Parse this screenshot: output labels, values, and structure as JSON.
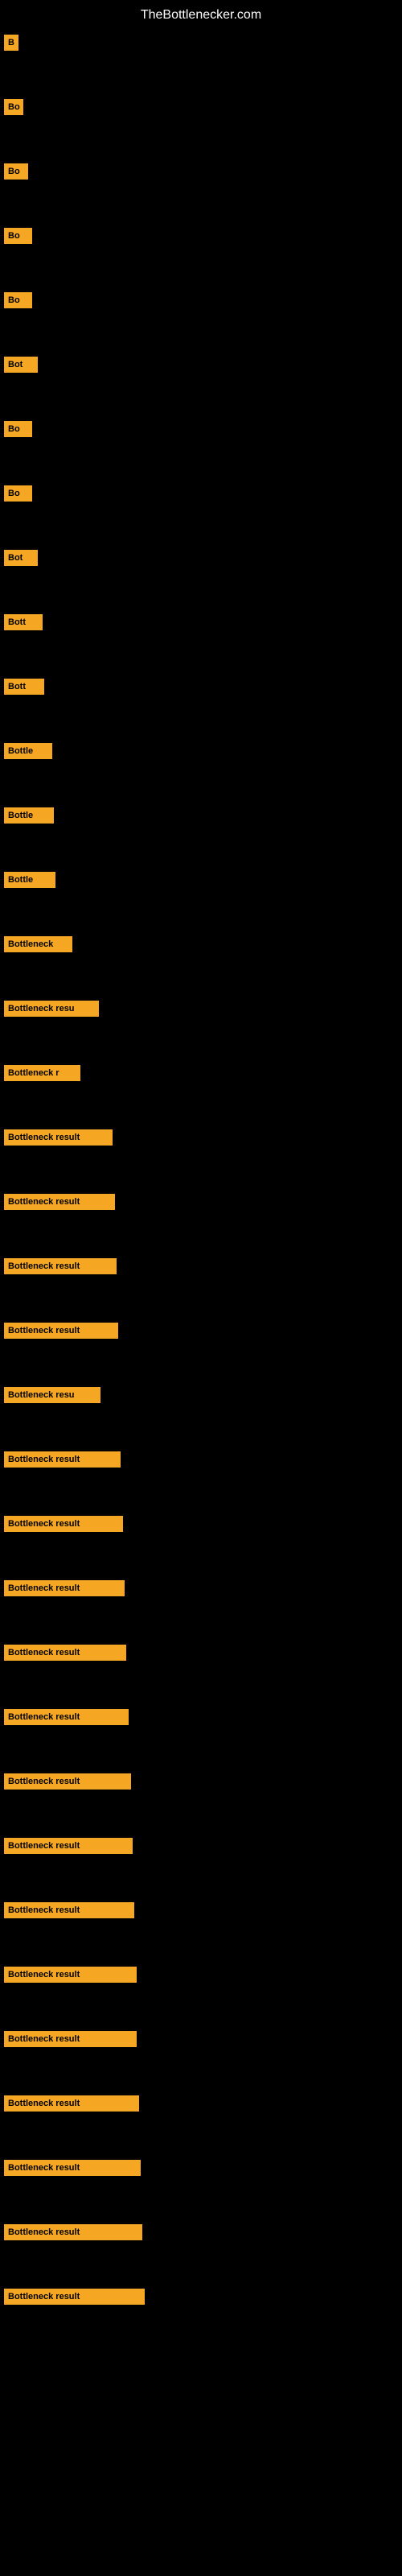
{
  "site": {
    "title": "TheBottlenecker.com"
  },
  "badges": [
    {
      "id": 1,
      "text": "B",
      "width": 18
    },
    {
      "id": 2,
      "text": "Bo",
      "width": 24
    },
    {
      "id": 3,
      "text": "Bo",
      "width": 30
    },
    {
      "id": 4,
      "text": "Bo",
      "width": 35
    },
    {
      "id": 5,
      "text": "Bo",
      "width": 35
    },
    {
      "id": 6,
      "text": "Bot",
      "width": 42
    },
    {
      "id": 7,
      "text": "Bo",
      "width": 35
    },
    {
      "id": 8,
      "text": "Bo",
      "width": 35
    },
    {
      "id": 9,
      "text": "Bot",
      "width": 42
    },
    {
      "id": 10,
      "text": "Bott",
      "width": 48
    },
    {
      "id": 11,
      "text": "Bott",
      "width": 50
    },
    {
      "id": 12,
      "text": "Bottle",
      "width": 60
    },
    {
      "id": 13,
      "text": "Bottle",
      "width": 62
    },
    {
      "id": 14,
      "text": "Bottle",
      "width": 64
    },
    {
      "id": 15,
      "text": "Bottleneck",
      "width": 85
    },
    {
      "id": 16,
      "text": "Bottleneck resu",
      "width": 118
    },
    {
      "id": 17,
      "text": "Bottleneck r",
      "width": 95
    },
    {
      "id": 18,
      "text": "Bottleneck result",
      "width": 135
    },
    {
      "id": 19,
      "text": "Bottleneck result",
      "width": 138
    },
    {
      "id": 20,
      "text": "Bottleneck result",
      "width": 140
    },
    {
      "id": 21,
      "text": "Bottleneck result",
      "width": 142
    },
    {
      "id": 22,
      "text": "Bottleneck resu",
      "width": 120
    },
    {
      "id": 23,
      "text": "Bottleneck result",
      "width": 145
    },
    {
      "id": 24,
      "text": "Bottleneck result",
      "width": 148
    },
    {
      "id": 25,
      "text": "Bottleneck result",
      "width": 150
    },
    {
      "id": 26,
      "text": "Bottleneck result",
      "width": 152
    },
    {
      "id": 27,
      "text": "Bottleneck result",
      "width": 155
    },
    {
      "id": 28,
      "text": "Bottleneck result",
      "width": 158
    },
    {
      "id": 29,
      "text": "Bottleneck result",
      "width": 160
    },
    {
      "id": 30,
      "text": "Bottleneck result",
      "width": 162
    },
    {
      "id": 31,
      "text": "Bottleneck result",
      "width": 165
    },
    {
      "id": 32,
      "text": "Bottleneck result",
      "width": 165
    },
    {
      "id": 33,
      "text": "Bottleneck result",
      "width": 168
    },
    {
      "id": 34,
      "text": "Bottleneck result",
      "width": 170
    },
    {
      "id": 35,
      "text": "Bottleneck result",
      "width": 172
    },
    {
      "id": 36,
      "text": "Bottleneck result",
      "width": 175
    }
  ]
}
